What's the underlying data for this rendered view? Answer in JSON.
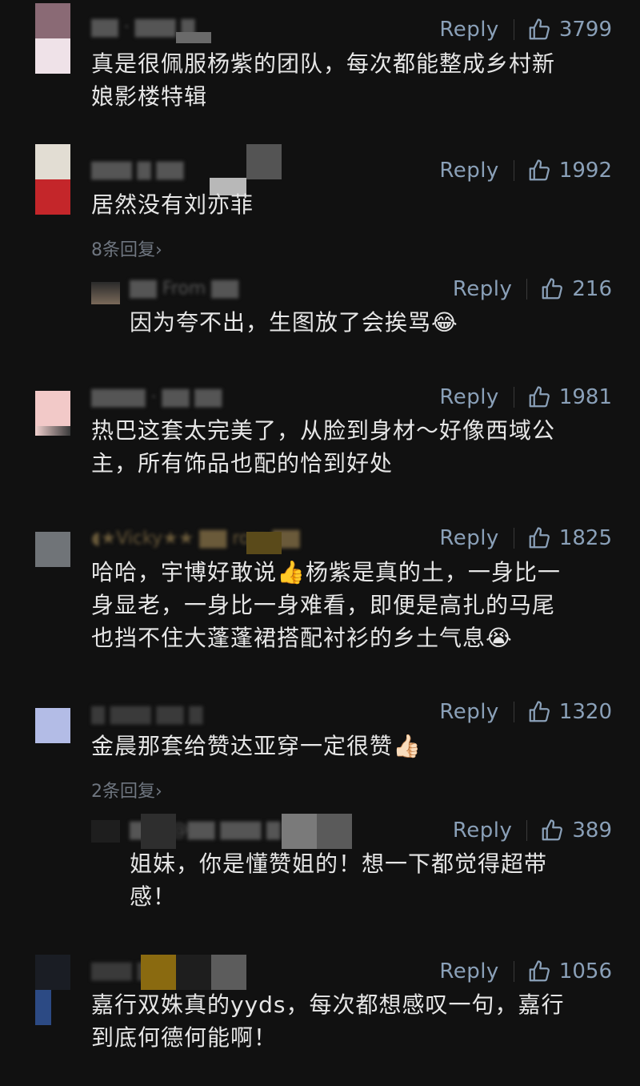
{
  "reply_label": "Reply",
  "more_suffix": "›",
  "comments": [
    {
      "avatar_colors": [
        "#8a6a75",
        "#efe2e8"
      ],
      "likes": "3799",
      "text_lines": [
        "真是很佩服杨紫的团队，每次都能整成乡村新",
        "娘影楼特辑"
      ]
    },
    {
      "avatar_colors": [
        "#e2ddd3",
        "#c4262a"
      ],
      "likes": "1992",
      "text_lines": [
        "居然没有刘亦菲"
      ],
      "more": "8条回复"
    },
    {
      "reply": true,
      "likes": "216",
      "text_lines": [
        "因为夸不出，生图放了会挨骂"
      ],
      "emoji": "😂"
    },
    {
      "avatar_colors": [
        "#f2c9c8",
        "#f0d0ce"
      ],
      "likes": "1981",
      "text_lines": [
        "热巴这套太完美了，从脸到身材～好像西域公",
        "主，所有饰品也配的恰到好处"
      ]
    },
    {
      "avatar_colors": [
        "#707478",
        "#1e1e1e"
      ],
      "likes": "1825",
      "text_lines": [
        "哈哈，宇博好敢说👍杨紫是真的土，一身比一",
        "身显老，一身比一身难看，即便是高扎的马尾",
        "也挡不住大蓬蓬裙搭配衬衫的乡土气息"
      ],
      "emoji": "😭"
    },
    {
      "avatar_colors": [
        "#b3bce6",
        "#c0c6ea"
      ],
      "likes": "1320",
      "text_lines": [
        "金晨那套给赞达亚穿一定很赞"
      ],
      "emoji": "👍🏻",
      "more": "2条回复"
    },
    {
      "reply": true,
      "likes": "389",
      "text_lines": [
        "姐妹，你是懂赞姐的！想一下都觉得超带",
        "感！"
      ]
    },
    {
      "avatar_colors": [
        "#1a1d24",
        "#2c4a84"
      ],
      "likes": "1056",
      "text_lines": [
        "嘉行双姝真的yyds，每次都想感叹一句，嘉行",
        "到底何德何能啊！"
      ]
    }
  ]
}
